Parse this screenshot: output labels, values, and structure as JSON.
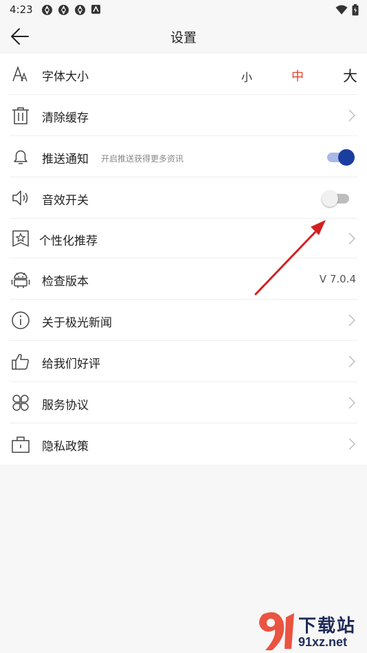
{
  "status_bar": {
    "time": "4:23"
  },
  "header": {
    "title": "设置"
  },
  "settings": {
    "font_size": {
      "label": "字体大小",
      "options": [
        "小",
        "中",
        "大"
      ],
      "selected": "中"
    },
    "clear_cache": {
      "label": "清除缓存"
    },
    "push_notify": {
      "label": "推送通知",
      "hint": "开启推送获得更多资讯",
      "enabled": true
    },
    "sound_effects": {
      "label": "音效开关",
      "enabled": false
    },
    "personalized": {
      "label": "个性化推荐"
    },
    "check_version": {
      "label": "检查版本",
      "version": "V 7.0.4"
    },
    "about": {
      "label": "关于极光新闻"
    },
    "rate_us": {
      "label": "给我们好评"
    },
    "service_agreement": {
      "label": "服务协议"
    },
    "privacy_policy": {
      "label": "隐私政策"
    }
  },
  "watermark": {
    "brand": "下载站",
    "site": "91xz.net"
  },
  "colors": {
    "accent_red": "#e8412c",
    "toggle_on": "#1a3ea0",
    "toggle_on_track": "#a9b8e6",
    "annotation_arrow": "#d42020"
  }
}
